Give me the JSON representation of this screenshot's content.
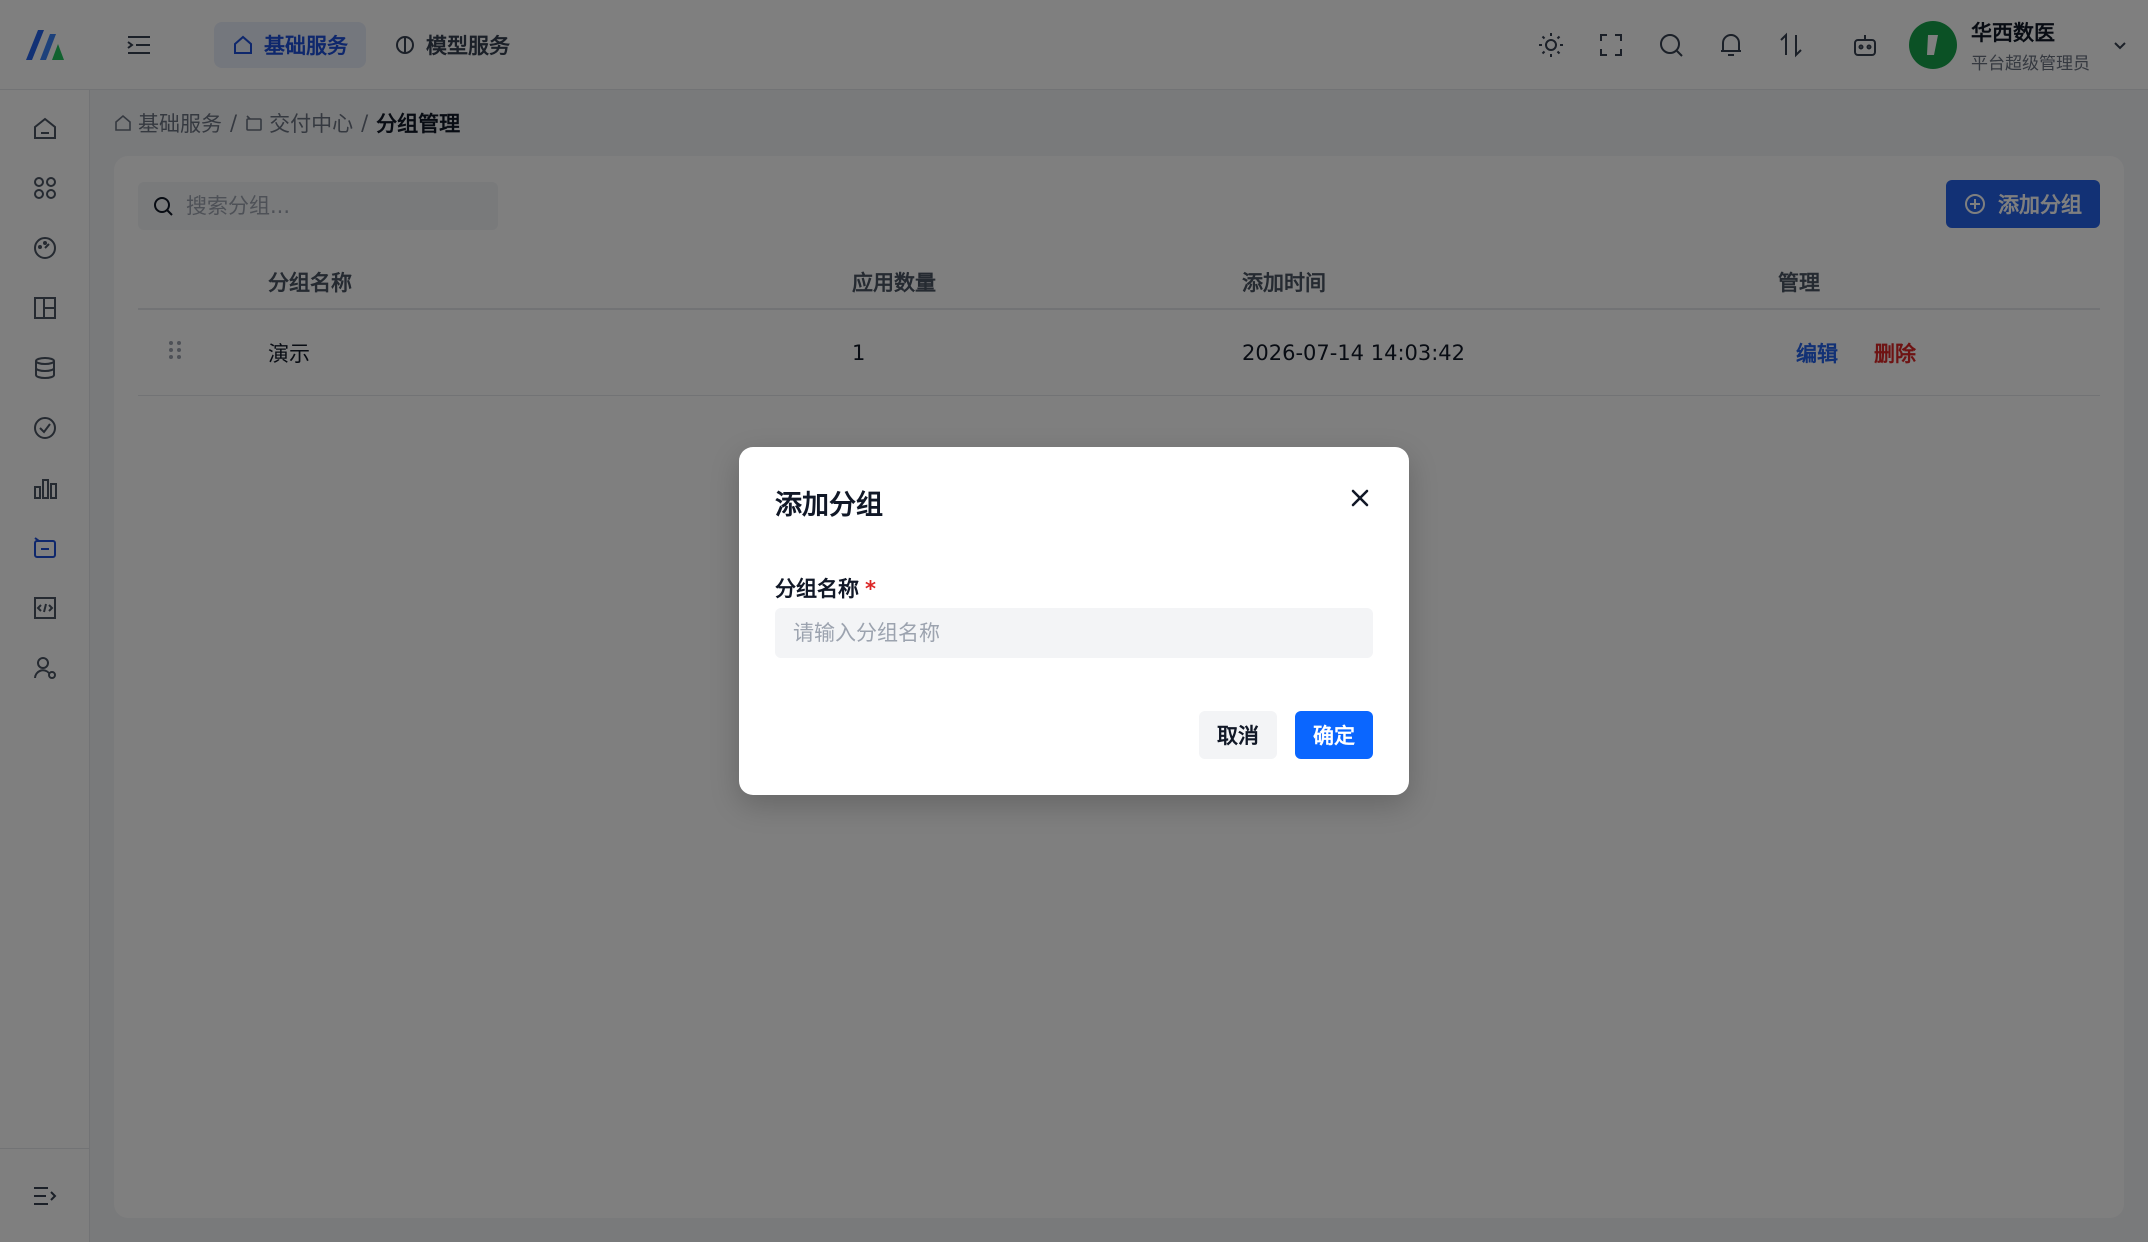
{
  "header": {
    "tabs": [
      {
        "label": "基础服务",
        "icon": "home-icon",
        "active": true
      },
      {
        "label": "模型服务",
        "icon": "brain-icon",
        "active": false
      }
    ],
    "icons": [
      "sun-icon",
      "fullscreen-icon",
      "search-icon",
      "bell-icon",
      "swap-icon",
      "robot-icon"
    ],
    "user": {
      "name": "华西数医",
      "role": "平台超级管理员"
    }
  },
  "sidebar": {
    "items": [
      "home-icon",
      "apps-icon",
      "dashboard-icon",
      "layout-icon",
      "database-icon",
      "check-circle-icon",
      "bar-chart-icon",
      "delivery-icon",
      "code-icon",
      "user-settings-icon"
    ],
    "active_index": 7
  },
  "breadcrumb": {
    "items": [
      "基础服务",
      "交付中心",
      "分组管理"
    ],
    "separator": "/"
  },
  "toolbar": {
    "search_placeholder": "搜索分组...",
    "add_button": "添加分组"
  },
  "table": {
    "columns": [
      "分组名称",
      "应用数量",
      "添加时间",
      "管理"
    ],
    "rows": [
      {
        "name": "演示",
        "count": "1",
        "time": "2026-07-14 14:03:42",
        "edit": "编辑",
        "delete": "删除"
      }
    ]
  },
  "modal": {
    "title": "添加分组",
    "field_label": "分组名称",
    "required_mark": "*",
    "field_placeholder": "请输入分组名称",
    "cancel": "取消",
    "confirm": "确定"
  },
  "colors": {
    "primary": "#2563eb",
    "danger": "#dc2626",
    "confirm": "#0a66ff"
  }
}
